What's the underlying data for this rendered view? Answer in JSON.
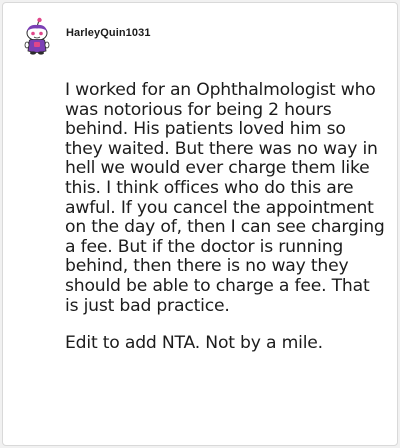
{
  "comment": {
    "username": "HarleyQuin1031",
    "avatar_icon": "snoo-avatar-icon",
    "paragraphs": [
      "I worked for an Ophthalmologist who was notorious for being 2 hours behind. His patients loved him so they waited. But there was no way in hell we would ever charge them like this. I think offices who do this are awful. If you cancel the appointment on the day of, then I can see charging a fee. But if the doctor is running behind, then there is no way they should be able to charge a fee. That is just bad practice.",
      "Edit to add NTA. Not by a mile."
    ]
  },
  "colors": {
    "background": "#f1f1f1",
    "card": "#ffffff",
    "text": "#1c1c1c",
    "avatar_body": "#7b3fb5",
    "avatar_accent": "#e0468a"
  }
}
